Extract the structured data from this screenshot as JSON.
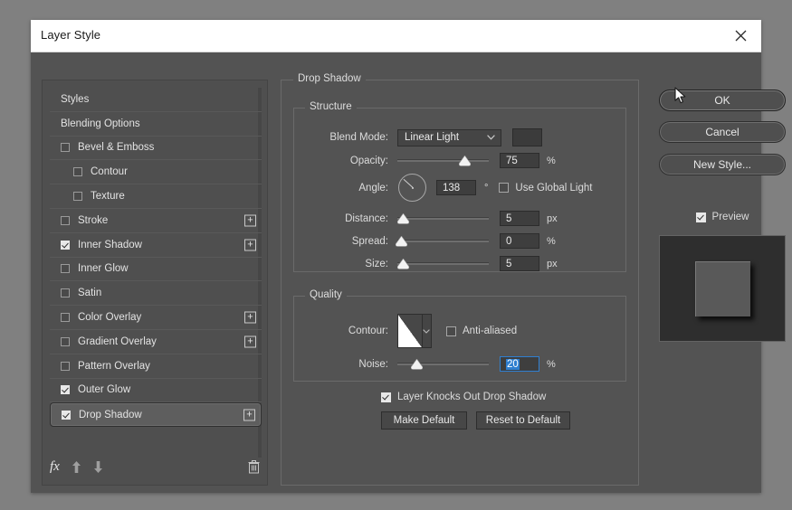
{
  "window": {
    "title": "Layer Style",
    "close_icon": "close-icon"
  },
  "sidebar": {
    "items": [
      {
        "label": "Styles",
        "type": "plain",
        "checkbox": null,
        "plus": false,
        "selected": false
      },
      {
        "label": "Blending Options",
        "type": "plain",
        "checkbox": null,
        "plus": false,
        "selected": false
      },
      {
        "label": "Bevel & Emboss",
        "type": "normal",
        "checkbox": false,
        "plus": false,
        "selected": false
      },
      {
        "label": "Contour",
        "type": "indent",
        "checkbox": false,
        "plus": false,
        "selected": false
      },
      {
        "label": "Texture",
        "type": "indent",
        "checkbox": false,
        "plus": false,
        "selected": false
      },
      {
        "label": "Stroke",
        "type": "normal",
        "checkbox": false,
        "plus": true,
        "selected": false
      },
      {
        "label": "Inner Shadow",
        "type": "normal",
        "checkbox": true,
        "plus": true,
        "selected": false
      },
      {
        "label": "Inner Glow",
        "type": "normal",
        "checkbox": false,
        "plus": false,
        "selected": false
      },
      {
        "label": "Satin",
        "type": "normal",
        "checkbox": false,
        "plus": false,
        "selected": false
      },
      {
        "label": "Color Overlay",
        "type": "normal",
        "checkbox": false,
        "plus": true,
        "selected": false
      },
      {
        "label": "Gradient Overlay",
        "type": "normal",
        "checkbox": false,
        "plus": true,
        "selected": false
      },
      {
        "label": "Pattern Overlay",
        "type": "normal",
        "checkbox": false,
        "plus": false,
        "selected": false
      },
      {
        "label": "Outer Glow",
        "type": "normal",
        "checkbox": true,
        "plus": false,
        "selected": false
      },
      {
        "label": "Drop Shadow",
        "type": "normal",
        "checkbox": true,
        "plus": true,
        "selected": true
      }
    ],
    "plus_label": "+",
    "footer": {
      "fx_label": "fx",
      "fx_icon": "fx-icon",
      "move_up_icon": "arrow-up-icon",
      "move_down_icon": "arrow-down-icon",
      "delete_icon": "trash-icon"
    }
  },
  "main": {
    "group_title": "Drop Shadow",
    "structure": {
      "title": "Structure",
      "blend_mode_label": "Blend Mode:",
      "blend_mode_value": "Linear Light",
      "blend_color": "#3b3b3b",
      "opacity_label": "Opacity:",
      "opacity_value": "75",
      "opacity_unit": "%",
      "opacity_percent": 75,
      "angle_label": "Angle:",
      "angle_value": "138",
      "angle_unit": "°",
      "angle_degrees": 138,
      "use_global_light_label": "Use Global Light",
      "use_global_light_checked": false,
      "distance_label": "Distance:",
      "distance_value": "5",
      "distance_unit": "px",
      "distance_percent": 2,
      "spread_label": "Spread:",
      "spread_value": "0",
      "spread_unit": "%",
      "spread_percent": 0,
      "size_label": "Size:",
      "size_value": "5",
      "size_unit": "px",
      "size_percent": 2
    },
    "quality": {
      "title": "Quality",
      "contour_label": "Contour:",
      "contour_icon": "contour-preset-icon",
      "anti_aliased_label": "Anti-aliased",
      "anti_aliased_checked": false,
      "noise_label": "Noise:",
      "noise_value": "20",
      "noise_unit": "%",
      "noise_percent": 17,
      "noise_focused": true
    },
    "knockout_label": "Layer Knocks Out Drop Shadow",
    "knockout_checked": true,
    "make_default_label": "Make Default",
    "reset_default_label": "Reset to Default"
  },
  "actions": {
    "ok_label": "OK",
    "cancel_label": "Cancel",
    "new_style_label": "New Style...",
    "preview_label": "Preview",
    "preview_checked": true
  },
  "colors": {
    "dialog_bg": "#535353",
    "page_bg": "#808080",
    "titlebar_bg": "#ffffff",
    "accent": "#2f7fd0",
    "text": "#e3e3e3"
  }
}
